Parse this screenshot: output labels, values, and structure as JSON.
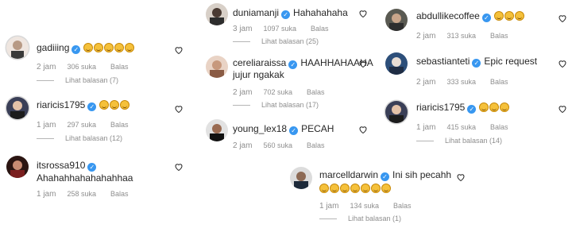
{
  "panels": {
    "left": [
      {
        "user": "gadiiing",
        "verified": true,
        "text": "",
        "emojis": 5,
        "time": "2 jam",
        "likes": "306 suka",
        "reply": "Balas",
        "view_replies": "Lihat balasan (7)"
      },
      {
        "user": "riaricis1795",
        "verified": true,
        "text": "",
        "emojis": 3,
        "time": "1 jam",
        "likes": "297 suka",
        "reply": "Balas",
        "view_replies": "Lihat balasan (12)"
      },
      {
        "user": "itsrossa910",
        "verified": true,
        "text": "Ahahahhahahahahhaa",
        "emojis": 0,
        "time": "1 jam",
        "likes": "258 suka",
        "reply": "Balas",
        "view_replies": ""
      }
    ],
    "middle": [
      {
        "user": "duniamanji",
        "verified": true,
        "text": "Hahahahaha",
        "emojis": 0,
        "time": "3 jam",
        "likes": "1097 suka",
        "reply": "Balas",
        "view_replies": "Lihat balasan (25)"
      },
      {
        "user": "cereliaraissa",
        "verified": true,
        "text": "HAAHHAHAAHA",
        "text2": "jujur ngakak",
        "emojis": 0,
        "time": "2 jam",
        "likes": "702 suka",
        "reply": "Balas",
        "view_replies": "Lihat balasan (17)"
      },
      {
        "user": "young_lex18",
        "verified": true,
        "text": "PECAH",
        "emojis": 0,
        "time": "2 jam",
        "likes": "560 suka",
        "reply": "Balas",
        "view_replies": ""
      }
    ],
    "right": [
      {
        "user": "abdullikecoffee",
        "verified": true,
        "text": "",
        "emojis": 3,
        "time": "2 jam",
        "likes": "313 suka",
        "reply": "Balas",
        "view_replies": ""
      },
      {
        "user": "sebastianteti",
        "verified": true,
        "text": "Epic request",
        "emojis": 0,
        "time": "2 jam",
        "likes": "333 suka",
        "reply": "Balas",
        "view_replies": ""
      },
      {
        "user": "riaricis1795",
        "verified": true,
        "text": "",
        "emojis": 3,
        "time": "1 jam",
        "likes": "415 suka",
        "reply": "Balas",
        "view_replies": "Lihat balasan (14)"
      }
    ],
    "bottom": [
      {
        "user": "marcelldarwin",
        "verified": true,
        "text": "Ini sih pecahh",
        "emojis": 7,
        "time": "1 jam",
        "likes": "134 suka",
        "reply": "Balas",
        "view_replies": "Lihat balasan (1)"
      }
    ]
  },
  "colors": {
    "verified": "#3897f0",
    "meta": "#8e8e8e",
    "text": "#262626"
  },
  "icons": {
    "verified": "verified-badge-icon",
    "like": "heart-icon",
    "emoji": "rolling-laughing-emoji-icon"
  }
}
